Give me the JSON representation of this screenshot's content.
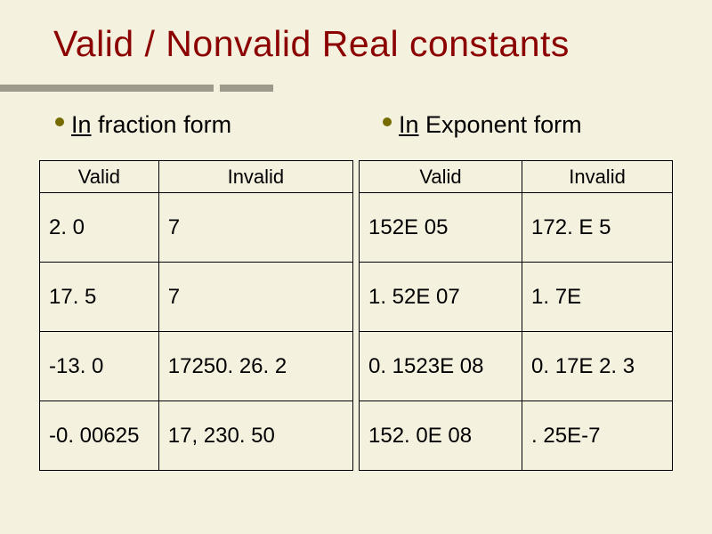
{
  "title": "Valid / Nonvalid Real constants",
  "bullets": {
    "left": {
      "prefix": "In",
      "rest": " fraction form"
    },
    "right": {
      "prefix": "In",
      "rest": " Exponent form"
    }
  },
  "tables": {
    "fraction": {
      "headers": [
        "Valid",
        "Invalid"
      ],
      "rows": [
        [
          "2. 0",
          "7"
        ],
        [
          "17. 5",
          "7"
        ],
        [
          "-13. 0",
          "17250. 26. 2"
        ],
        [
          "-0. 00625",
          "17, 230. 50"
        ]
      ]
    },
    "exponent": {
      "headers": [
        "Valid",
        "Invalid"
      ],
      "rows": [
        [
          "152E 05",
          "172. E 5"
        ],
        [
          "1. 52E 07",
          "1. 7E"
        ],
        [
          "0. 1523E 08",
          "0. 17E 2. 3"
        ],
        [
          "152. 0E 08",
          ". 25E-7"
        ]
      ]
    }
  }
}
